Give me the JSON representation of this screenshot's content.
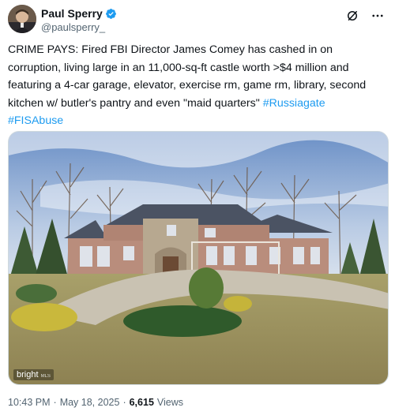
{
  "author": {
    "display_name": "Paul Sperry",
    "handle": "@paulsperry_",
    "verified": true
  },
  "header_icons": [
    "grok-icon",
    "more-options-icon"
  ],
  "post": {
    "text_main": "CRIME PAYS: Fired FBI Director James Comey has cashed in on corruption, living large in an 11,000-sq-ft castle worth >$4 million and featuring a 4-car garage, elevator, exercise rm, game rm, library, second kitchen w/ butler's pantry and even \"maid quarters\" ",
    "hashtag_1": "#Russiagate",
    "hashtag_2": "#FISAbuse"
  },
  "media": {
    "watermark": "bright",
    "watermark_suffix": "MLS"
  },
  "meta": {
    "time": "10:43 PM",
    "date": "May 18, 2025",
    "separator": "·",
    "views_count": "6,615",
    "views_label": "Views"
  },
  "colors": {
    "link": "#1d9bf0",
    "verified": "#1d9bf0",
    "secondary_text": "#536471"
  }
}
